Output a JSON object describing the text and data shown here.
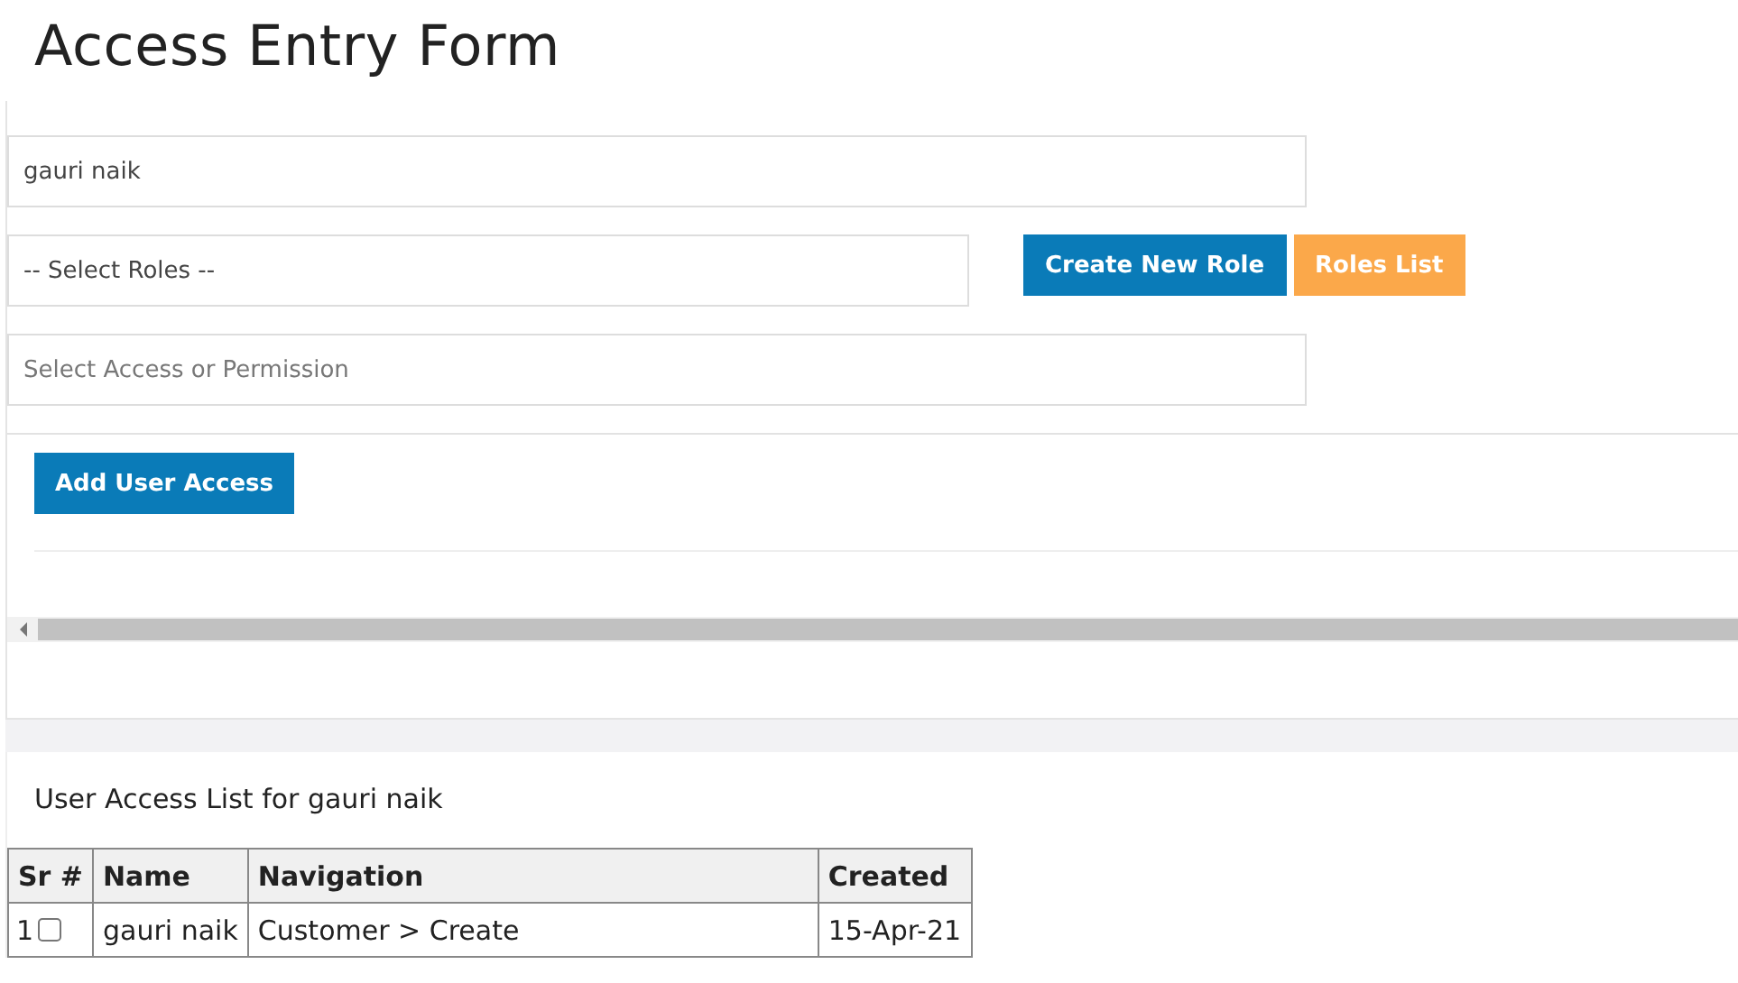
{
  "title": "Access Entry Form",
  "fields": [
    {
      "kind": "input",
      "value": "gauri naik"
    },
    {
      "kind": "select",
      "value": "-- Select Roles --"
    },
    {
      "kind": "input",
      "placeholder": "Select Access or Permission"
    }
  ],
  "role_buttons": [
    {
      "label": "Create New Role",
      "kind": "primary"
    },
    {
      "label": "Roles List",
      "kind": "warning"
    }
  ],
  "add_button": "Add User Access",
  "list_title": "User Access List for gauri naik",
  "table": {
    "columns": [
      "Sr #",
      "Name",
      "Navigation",
      "Created"
    ],
    "rows": [
      {
        "sr": "1",
        "checked": false,
        "name": "gauri naik",
        "navigation": "Customer > Create",
        "created": "15-Apr-21"
      }
    ]
  }
}
